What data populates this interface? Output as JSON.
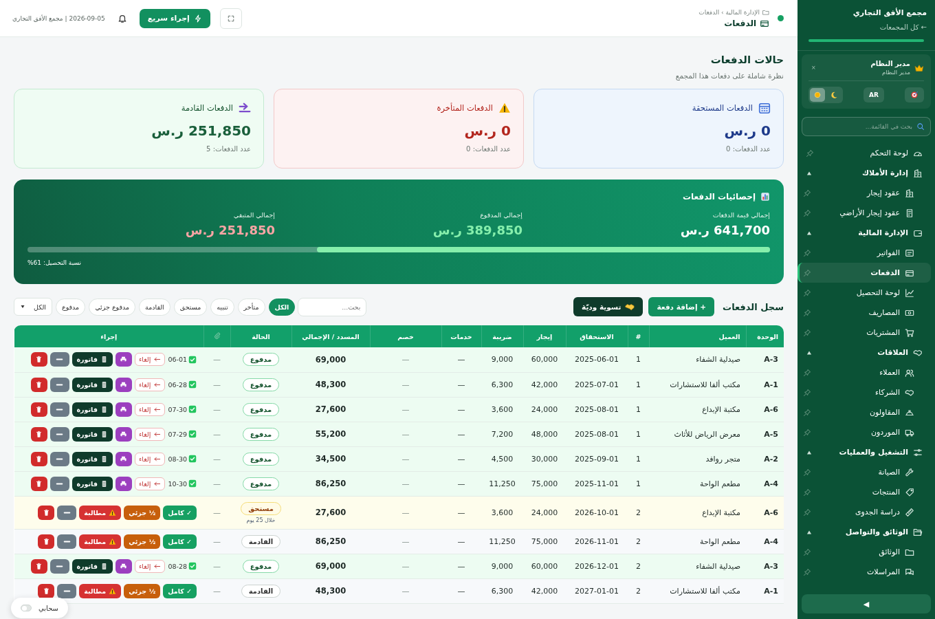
{
  "sidebar": {
    "title": "مجمع الأفق التجاري",
    "back_link": "← كل المجمعات",
    "user": {
      "name": "مدير النظام",
      "role": "مدير النظام",
      "close": "×"
    },
    "theme": [
      {
        "kind": "dark",
        "selected": false
      },
      {
        "kind": "light",
        "selected": true
      }
    ],
    "language": "AR",
    "search": {
      "placeholder": "بحث في القائمة..."
    },
    "items": [
      {
        "label": "لوحة التحكم",
        "selected": false
      },
      {
        "label": "إدارة الأملاك",
        "expanded": true,
        "children": [
          {
            "label": "عقود إيجار",
            "selected": false
          },
          {
            "label": "عقود إيجار الأراضي",
            "selected": false
          }
        ]
      },
      {
        "label": "الإدارة المالية",
        "expanded": true,
        "children": [
          {
            "label": "الفواتير",
            "selected": false
          },
          {
            "label": "الدفعات",
            "selected": true
          },
          {
            "label": "لوحة التحصيل",
            "selected": false
          },
          {
            "label": "المصاريف",
            "selected": false
          },
          {
            "label": "المشتريات",
            "selected": false
          }
        ]
      },
      {
        "label": "العلاقات",
        "expanded": true,
        "children": [
          {
            "label": "العملاء",
            "selected": false
          },
          {
            "label": "الشركاء",
            "selected": false
          },
          {
            "label": "المقاولون",
            "selected": false
          },
          {
            "label": "الموردون",
            "selected": false
          }
        ]
      },
      {
        "label": "التشغيل والعمليات",
        "expanded": true,
        "children": [
          {
            "label": "الصيانة",
            "selected": false
          },
          {
            "label": "المنتجات",
            "selected": false
          },
          {
            "label": "دراسة الجدوى",
            "selected": false
          }
        ]
      },
      {
        "label": "الوثائق والتواصل",
        "expanded": true,
        "children": [
          {
            "label": "الوثائق",
            "selected": false
          },
          {
            "label": "المراسلات",
            "selected": false
          }
        ]
      }
    ],
    "collapse": "◀"
  },
  "header": {
    "breadcrumb": "الإدارة المالية › الدفعات",
    "title": "الدفعات",
    "quick_action": "إجراء سريع",
    "date_info": "2026-09-05 | مجمع الأفق التجاري"
  },
  "overview": {
    "title": "حالات الدفعات",
    "subtitle": "نظرة شاملة على دفعات هذا المجمع",
    "cards": [
      {
        "kind": "due",
        "title": "الدفعات المستحقة",
        "amount": "0 ر.س",
        "count": "عدد الدفعات: 0"
      },
      {
        "kind": "overdue",
        "title": "الدفعات المتأخرة",
        "amount": "0 ر.س",
        "count": "عدد الدفعات: 0"
      },
      {
        "kind": "upcoming",
        "title": "الدفعات القادمة",
        "amount": "251,850 ر.س",
        "count": "عدد الدفعات: 5"
      }
    ]
  },
  "stats": {
    "title": "إحصائيات الدفعات",
    "items": [
      {
        "kind": "total",
        "label": "إجمالي قيمة الدفعات",
        "value": "641,700 ر.س"
      },
      {
        "kind": "paid",
        "label": "إجمالي المدفوع",
        "value": "389,850 ر.س"
      },
      {
        "kind": "remaining",
        "label": "إجمالي المتبقي",
        "value": "251,850 ر.س"
      }
    ],
    "collection": {
      "level": 0.61,
      "label": "نسبة التحصيل: 61%"
    }
  },
  "ledger": {
    "title": "سجل الدفعات",
    "add_button": "+ إضافة دفعة",
    "settle_button": "تسوية وديّة",
    "search": {
      "placeholder": "بحث..."
    },
    "filters": [
      {
        "label": "الكل",
        "selected": true
      },
      {
        "label": "متأخر",
        "selected": false
      },
      {
        "label": "تنبيه",
        "selected": false
      },
      {
        "label": "مستحق",
        "selected": false
      },
      {
        "label": "القادمة",
        "selected": false
      },
      {
        "label": "مدفوع جزئي",
        "selected": false
      },
      {
        "label": "مدفوع",
        "selected": false
      }
    ],
    "select": {
      "value": "الكل"
    }
  },
  "table": {
    "columns": [
      {
        "kind": "text",
        "label": "الوحدة"
      },
      {
        "kind": "text",
        "label": "العميل"
      },
      {
        "kind": "text",
        "label": "#"
      },
      {
        "kind": "text",
        "label": "الاستحقاق"
      },
      {
        "kind": "text",
        "label": "إيجار"
      },
      {
        "kind": "text",
        "label": "ضريبة"
      },
      {
        "kind": "text",
        "label": "خدمات"
      },
      {
        "kind": "text",
        "label": "خصم"
      },
      {
        "kind": "text",
        "label": "المسدد / الإجمالي"
      },
      {
        "kind": "text",
        "label": "الحالة"
      },
      {
        "kind": "attachment"
      },
      {
        "kind": "text",
        "label": "إجراء"
      }
    ],
    "rows": [
      {
        "kind": "paid",
        "unit": "A-3",
        "client": "صيدلية الشفاء",
        "installment": "1",
        "due": "2025-06-01",
        "rent": "60,000",
        "tax": "9,000",
        "services": "—",
        "discount": "—",
        "total": "69,000",
        "status_label": "مدفوع",
        "attachment": "—",
        "paid_on": "06-01",
        "actions": [
          {
            "kind": "cancel",
            "label": "إلغاء"
          },
          {
            "kind": "print"
          },
          {
            "kind": "invoice",
            "label": "فاتورة"
          },
          {
            "kind": "hide"
          },
          {
            "kind": "delete"
          }
        ]
      },
      {
        "kind": "paid",
        "unit": "A-1",
        "client": "مكتب ألفا للاستشارات",
        "installment": "1",
        "due": "2025-07-01",
        "rent": "42,000",
        "tax": "6,300",
        "services": "—",
        "discount": "—",
        "total": "48,300",
        "status_label": "مدفوع",
        "attachment": "—",
        "paid_on": "06-28",
        "actions": [
          {
            "kind": "cancel",
            "label": "إلغاء"
          },
          {
            "kind": "print"
          },
          {
            "kind": "invoice",
            "label": "فاتورة"
          },
          {
            "kind": "hide"
          },
          {
            "kind": "delete"
          }
        ]
      },
      {
        "kind": "paid",
        "unit": "A-6",
        "client": "مكتبة الإبداع",
        "installment": "1",
        "due": "2025-08-01",
        "rent": "24,000",
        "tax": "3,600",
        "services": "—",
        "discount": "—",
        "total": "27,600",
        "status_label": "مدفوع",
        "attachment": "—",
        "paid_on": "07-30",
        "actions": [
          {
            "kind": "cancel",
            "label": "إلغاء"
          },
          {
            "kind": "print"
          },
          {
            "kind": "invoice",
            "label": "فاتورة"
          },
          {
            "kind": "hide"
          },
          {
            "kind": "delete"
          }
        ]
      },
      {
        "kind": "paid",
        "unit": "A-5",
        "client": "معرض الرياض للأثاث",
        "installment": "1",
        "due": "2025-08-01",
        "rent": "48,000",
        "tax": "7,200",
        "services": "—",
        "discount": "—",
        "total": "55,200",
        "status_label": "مدفوع",
        "attachment": "—",
        "paid_on": "07-29",
        "actions": [
          {
            "kind": "cancel",
            "label": "إلغاء"
          },
          {
            "kind": "print"
          },
          {
            "kind": "invoice",
            "label": "فاتورة"
          },
          {
            "kind": "hide"
          },
          {
            "kind": "delete"
          }
        ]
      },
      {
        "kind": "paid",
        "unit": "A-2",
        "client": "متجر روافد",
        "installment": "1",
        "due": "2025-09-01",
        "rent": "30,000",
        "tax": "4,500",
        "services": "—",
        "discount": "—",
        "total": "34,500",
        "status_label": "مدفوع",
        "attachment": "—",
        "paid_on": "08-30",
        "actions": [
          {
            "kind": "cancel",
            "label": "إلغاء"
          },
          {
            "kind": "print"
          },
          {
            "kind": "invoice",
            "label": "فاتورة"
          },
          {
            "kind": "hide"
          },
          {
            "kind": "delete"
          }
        ]
      },
      {
        "kind": "paid",
        "unit": "A-4",
        "client": "مطعم الواحة",
        "installment": "1",
        "due": "2025-11-01",
        "rent": "75,000",
        "tax": "11,250",
        "services": "—",
        "discount": "—",
        "total": "86,250",
        "status_label": "مدفوع",
        "attachment": "—",
        "paid_on": "10-30",
        "actions": [
          {
            "kind": "cancel",
            "label": "إلغاء"
          },
          {
            "kind": "print"
          },
          {
            "kind": "invoice",
            "label": "فاتورة"
          },
          {
            "kind": "hide"
          },
          {
            "kind": "delete"
          }
        ]
      },
      {
        "kind": "due",
        "unit": "A-6",
        "client": "مكتبة الإبداع",
        "installment": "2",
        "due": "2026-10-01",
        "rent": "24,000",
        "tax": "3,600",
        "services": "—",
        "discount": "—",
        "total": "27,600",
        "status_label": "مستحق",
        "note": "خلال 25 يوم",
        "attachment": "—",
        "actions": [
          {
            "kind": "full",
            "label": "✓ كامل"
          },
          {
            "kind": "partial",
            "label": "½ جزئي"
          },
          {
            "kind": "claim",
            "label": "مطالبة"
          },
          {
            "kind": "hide"
          },
          {
            "kind": "delete"
          }
        ]
      },
      {
        "kind": "upcoming",
        "unit": "A-4",
        "client": "مطعم الواحة",
        "installment": "2",
        "due": "2026-11-01",
        "rent": "75,000",
        "tax": "11,250",
        "services": "—",
        "discount": "—",
        "total": "86,250",
        "status_label": "القادمة",
        "attachment": "—",
        "actions": [
          {
            "kind": "full",
            "label": "✓ كامل"
          },
          {
            "kind": "partial",
            "label": "½ جزئي"
          },
          {
            "kind": "claim",
            "label": "مطالبة"
          },
          {
            "kind": "hide"
          },
          {
            "kind": "delete"
          }
        ]
      },
      {
        "kind": "paid",
        "unit": "A-3",
        "client": "صيدلية الشفاء",
        "installment": "2",
        "due": "2026-12-01",
        "rent": "60,000",
        "tax": "9,000",
        "services": "—",
        "discount": "—",
        "total": "69,000",
        "status_label": "مدفوع",
        "attachment": "—",
        "paid_on": "08-28",
        "actions": [
          {
            "kind": "cancel",
            "label": "إلغاء"
          },
          {
            "kind": "print"
          },
          {
            "kind": "invoice",
            "label": "فاتورة"
          },
          {
            "kind": "hide"
          },
          {
            "kind": "delete"
          }
        ]
      },
      {
        "kind": "upcoming",
        "unit": "A-1",
        "client": "مكتب ألفا للاستشارات",
        "installment": "2",
        "due": "2027-01-01",
        "rent": "42,000",
        "tax": "6,300",
        "services": "—",
        "discount": "—",
        "total": "48,300",
        "status_label": "القادمة",
        "attachment": "—",
        "actions": [
          {
            "kind": "full",
            "label": "✓ كامل"
          },
          {
            "kind": "partial",
            "label": "½ جزئي"
          },
          {
            "kind": "claim",
            "label": "مطالبة"
          },
          {
            "kind": "hide"
          },
          {
            "kind": "delete"
          }
        ]
      }
    ]
  },
  "cloud_toggle": {
    "label": "سحابي",
    "on": false
  }
}
